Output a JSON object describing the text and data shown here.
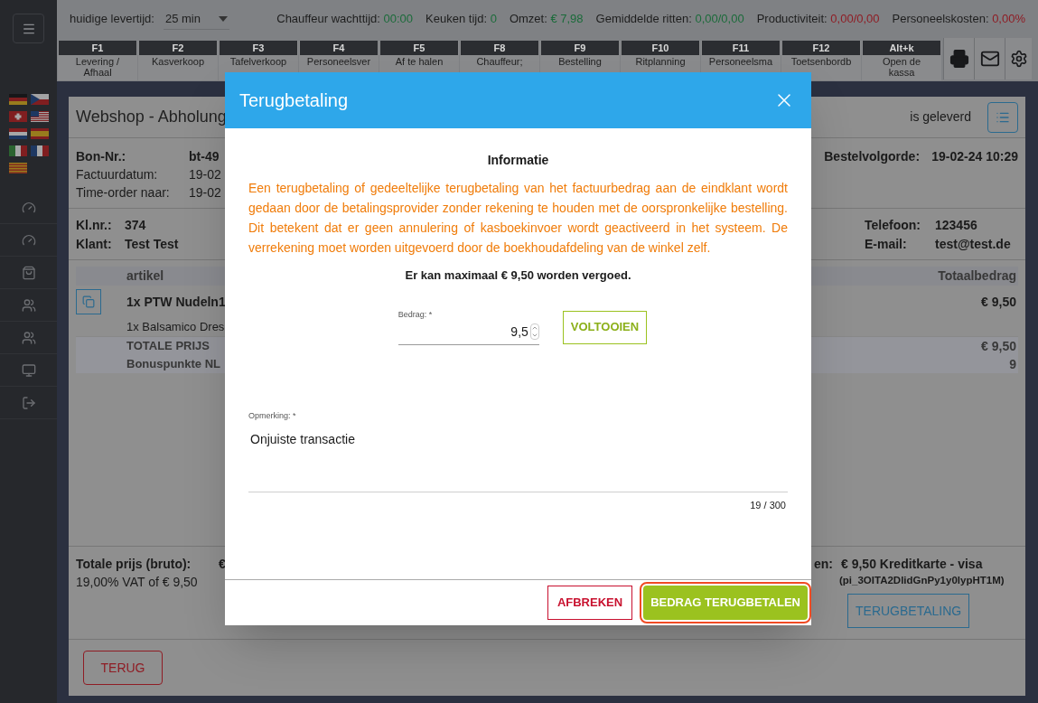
{
  "topbar": {
    "delivery_label": "huidige levertijd:",
    "delivery_value": "25 min",
    "stats": [
      {
        "label": "Chauffeur wachttijd:",
        "value": "00:00",
        "color": "#1b6b3a"
      },
      {
        "label": "Keuken tijd:",
        "value": "0",
        "color": "#1b6b3a"
      },
      {
        "label": "Omzet:",
        "value": "€ 7,98",
        "color": "#1b6b3a"
      },
      {
        "label": "Gemiddelde ritten:",
        "value": "0,00/0,00",
        "color": "#1b6b3a"
      },
      {
        "label": "Productiviteit:",
        "value": "0,00/0,00",
        "color": "#8f1c24"
      },
      {
        "label": "Personeelskosten:",
        "value": "0,00%",
        "color": "#8f1c24"
      }
    ]
  },
  "function_keys": [
    {
      "key": "F1",
      "lines": [
        "Levering /",
        "Afhaal"
      ]
    },
    {
      "key": "F2",
      "lines": [
        "Kasverkoop"
      ]
    },
    {
      "key": "F3",
      "lines": [
        "Tafelverkoop"
      ]
    },
    {
      "key": "F4",
      "lines": [
        "Personeelsver"
      ]
    },
    {
      "key": "F5",
      "lines": [
        "Af te halen"
      ]
    },
    {
      "key": "F8",
      "lines": [
        "Chauffeur;"
      ]
    },
    {
      "key": "F9",
      "lines": [
        "Bestelling"
      ]
    },
    {
      "key": "F10",
      "lines": [
        "Ritplanning"
      ]
    },
    {
      "key": "F11",
      "lines": [
        "Personeelsma"
      ]
    },
    {
      "key": "F12",
      "lines": [
        "Toetsenbordb"
      ]
    },
    {
      "key": "Alt+k",
      "lines": [
        "Open de",
        "kassa"
      ]
    }
  ],
  "flags": [
    {
      "kind": "de"
    },
    {
      "kind": "cz"
    },
    {
      "kind": "ch"
    },
    {
      "kind": "us"
    },
    {
      "kind": "nl"
    },
    {
      "kind": "es"
    },
    {
      "kind": "it"
    },
    {
      "kind": "fr"
    },
    {
      "kind": "cat"
    }
  ],
  "order": {
    "title": "Webshop - Abholung",
    "status": "is geleverd",
    "info": [
      {
        "label": "Bon-Nr.:",
        "value": "bt-49",
        "kind": "strong"
      },
      {
        "label": "Factuurdatum:",
        "value": "19-02",
        "kind": "plain"
      },
      {
        "label": "Time-order naar:",
        "value": "19-02",
        "kind": "plain"
      }
    ],
    "info_right": {
      "label": "Bestelvolgorde:",
      "value": "19-02-24 10:29"
    },
    "customer_left": [
      {
        "label": "Kl.nr.:",
        "value": "374"
      },
      {
        "label": "Klant:",
        "value": "Test Test"
      }
    ],
    "customer_right": [
      {
        "label": "Telefoon:",
        "value": "123456"
      },
      {
        "label": "E-mail:",
        "value": "test@test.de"
      }
    ],
    "columns": [
      "artikel",
      "Totaalbedrag"
    ],
    "items": [
      {
        "name": "1x PTW Nudeln1",
        "total": "€ 9,50",
        "detail": "1x Balsamico Dres"
      }
    ],
    "totals": [
      {
        "label": "TOTALE PRIJS",
        "value": "€ 9,50"
      },
      {
        "label": "Bonuspunkte NL",
        "value": "9"
      }
    ],
    "summary_label": "Totale prijs (bruto):",
    "summary_value": "€",
    "vat": "19,00% VAT of € 9,50",
    "payment_label": "en:",
    "payment_value": "€ 9,50 Kreditkarte - visa",
    "payment_ref": "(pi_3OITA2DlidGnPy1y0lypHT1M)",
    "refund_button": "TERUGBETALING",
    "back_button": "TERUG"
  },
  "modal": {
    "title": "Terugbetaling",
    "heading": "Informatie",
    "notice": "Een terugbetaling of gedeeltelijke terugbetaling van het factuurbedrag aan de eindklant wordt gedaan door de betalingsprovider zonder rekening te houden met de oorspronkelijke bestelling. Dit betekent dat er geen annulering of kasboekinvoer wordt geactiveerd in het systeem. De verrekening moet worden uitgevoerd door de boekhoudafdeling van de winkel zelf.",
    "max_text": "Er kan maximaal € 9,50 worden vergoed.",
    "amount_label": "Bedrag: *",
    "amount_value": "9,5",
    "complete_button": "VOLTOOIEN",
    "remark_label": "Opmerking: *",
    "remark_value": "Onjuiste transactie",
    "counter": "19 / 300",
    "cancel_button": "AFBREKEN",
    "confirm_button": {
      "label": "BEDRAG TERUGBETALEN",
      "focused": true
    }
  }
}
